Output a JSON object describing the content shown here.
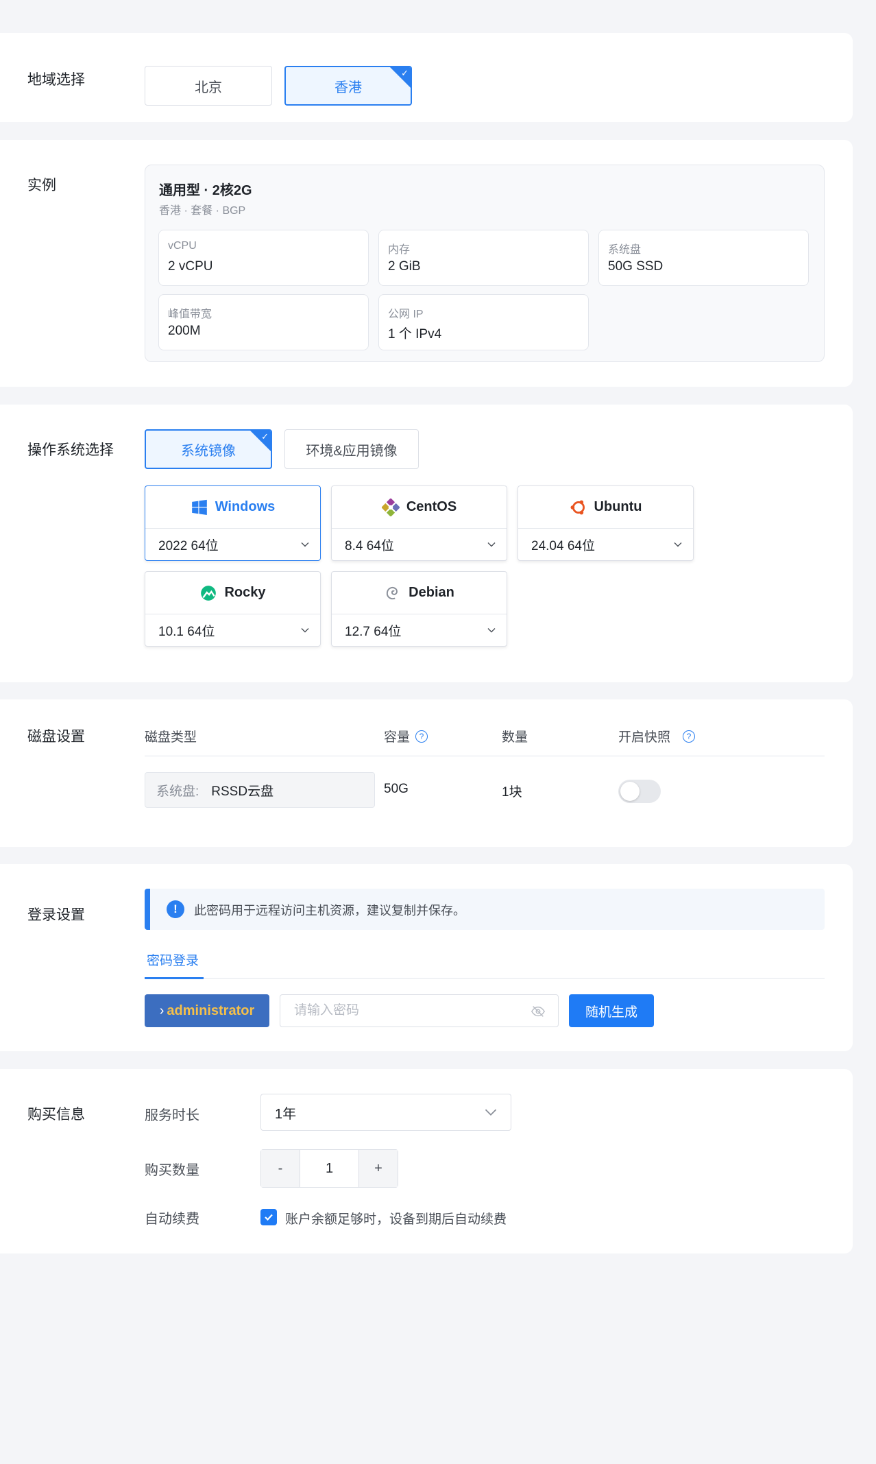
{
  "region": {
    "label": "地域选择",
    "options": [
      {
        "label": "北京",
        "selected": false
      },
      {
        "label": "香港",
        "selected": true
      }
    ]
  },
  "instance": {
    "label": "实例",
    "title": "通用型 · 2核2G",
    "subtitle": "香港 · 套餐 · BGP",
    "specs": [
      {
        "label": "vCPU",
        "value": "2 vCPU"
      },
      {
        "label": "内存",
        "value": "2 GiB"
      },
      {
        "label": "系统盘",
        "value": "50G SSD"
      },
      {
        "label": "峰值带宽",
        "value": "200M"
      },
      {
        "label": "公网 IP",
        "value": "1 个 IPv4"
      }
    ]
  },
  "os": {
    "label": "操作系统选择",
    "tabs": [
      {
        "label": "系统镜像",
        "selected": true
      },
      {
        "label": "环境&应用镜像",
        "selected": false
      }
    ],
    "images": [
      {
        "name": "Windows",
        "version": "2022 64位",
        "icon": "windows-icon",
        "selected": true
      },
      {
        "name": "CentOS",
        "version": "8.4 64位",
        "icon": "centos-icon",
        "selected": false
      },
      {
        "name": "Ubuntu",
        "version": "24.04 64位",
        "icon": "ubuntu-icon",
        "selected": false
      },
      {
        "name": "Rocky",
        "version": "10.1 64位",
        "icon": "rocky-icon",
        "selected": false
      },
      {
        "name": "Debian",
        "version": "12.7 64位",
        "icon": "debian-icon",
        "selected": false
      }
    ]
  },
  "disk": {
    "label": "磁盘设置",
    "headers": {
      "type": "磁盘类型",
      "capacity": "容量",
      "count": "数量",
      "snapshot": "开启快照"
    },
    "row": {
      "type_key": "系统盘:",
      "type_value": "RSSD云盘",
      "capacity": "50G",
      "count": "1块",
      "snapshot_enabled": false
    }
  },
  "login": {
    "label": "登录设置",
    "notice": "此密码用于远程访问主机资源，建议复制并保存。",
    "tab": "密码登录",
    "username": "administrator",
    "password_placeholder": "请输入密码",
    "generate_label": "随机生成"
  },
  "purchase": {
    "label": "购买信息",
    "duration_label": "服务时长",
    "duration_value": "1年",
    "quantity_label": "购买数量",
    "quantity_value": "1",
    "minus": "-",
    "plus": "+",
    "auto_renew_label": "自动续费",
    "auto_renew_checked": true,
    "auto_renew_text": "账户余额足够时，设备到期后自动续费"
  },
  "colors": {
    "accent": "#2a7ff0",
    "page_bg": "#f4f5f8",
    "username_text": "#f5c04a",
    "username_bg": "#3c6ec0"
  }
}
